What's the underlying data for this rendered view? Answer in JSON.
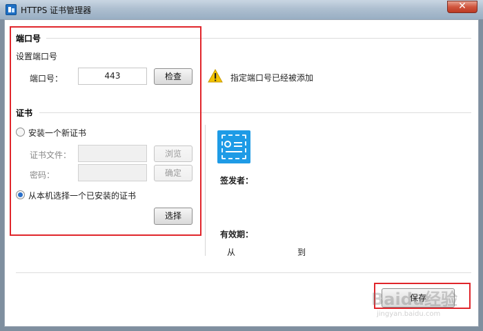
{
  "window": {
    "title": "HTTPS 证书管理器",
    "close_glyph": "✕"
  },
  "port_section": {
    "title": "端口号",
    "subtitle": "设置端口号",
    "port_label": "端口号：",
    "port_value": "443",
    "check_button": "检查",
    "status_message": "指定端口号已经被添加",
    "status_icon": "warning-icon"
  },
  "cert_section": {
    "title": "证书",
    "option_new": "安装一个新证书",
    "file_label": "证书文件：",
    "browse_button": "浏览",
    "password_label": "密码：",
    "confirm_button": "确定",
    "option_installed": "从本机选择一个已安装的证书",
    "selected_option": "installed",
    "select_button": "选择"
  },
  "cert_info": {
    "icon": "certificate-icon",
    "issuer_label": "签发者：",
    "validity_label": "有效期：",
    "from_label": "从",
    "to_label": "到"
  },
  "footer": {
    "save_button": "保存"
  },
  "watermark": {
    "text": "Baidu经验",
    "sub": "jingyan.baidu.com"
  },
  "colors": {
    "highlight_box": "#e0242a",
    "warning": "#f2c200",
    "cert_icon": "#1e9be6",
    "radio_checked": "#2a6fc9"
  }
}
